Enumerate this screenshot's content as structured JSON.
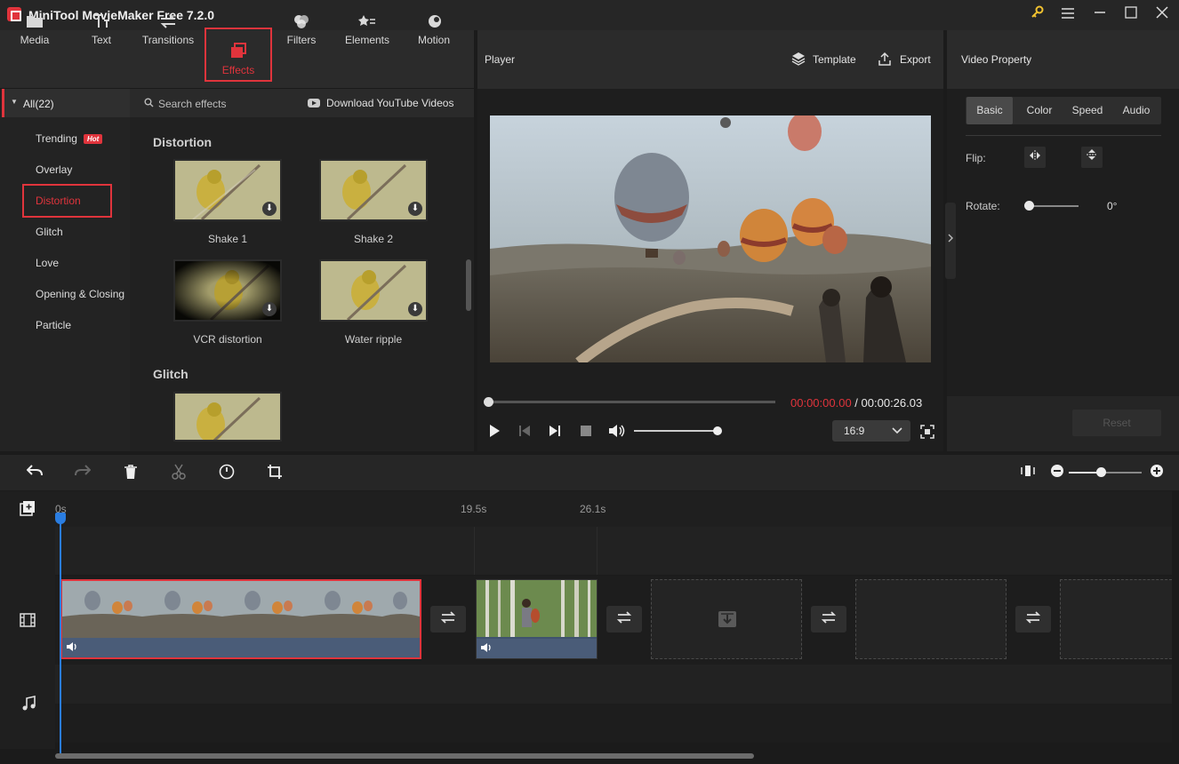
{
  "window": {
    "title": "MiniTool MovieMaker Free 7.2.0",
    "controls": [
      "key-icon",
      "menu-icon",
      "minimize-icon",
      "maximize-icon",
      "close-icon"
    ]
  },
  "toolbar": {
    "items": [
      {
        "label": "Media",
        "icon": "folder-icon"
      },
      {
        "label": "Text",
        "icon": "text-icon"
      },
      {
        "label": "Transitions",
        "icon": "swap-icon"
      },
      {
        "label": "Effects",
        "icon": "effects-icon",
        "selected": true
      },
      {
        "label": "Filters",
        "icon": "filters-icon"
      },
      {
        "label": "Elements",
        "icon": "elements-icon"
      },
      {
        "label": "Motion",
        "icon": "motion-icon"
      }
    ]
  },
  "categories": {
    "all_label": "All(22)",
    "items": [
      "Trending",
      "Overlay",
      "Distortion",
      "Glitch",
      "Love",
      "Opening & Closing",
      "Particle"
    ],
    "hot_badge": "Hot",
    "selected": "Distortion"
  },
  "effects": {
    "search_placeholder": "Search effects",
    "download_link": "Download YouTube Videos",
    "sections": [
      {
        "title": "Distortion",
        "items": [
          "Shake 1",
          "Shake 2",
          "VCR distortion",
          "Water ripple"
        ]
      },
      {
        "title": "Glitch",
        "items": [
          ""
        ]
      }
    ]
  },
  "player": {
    "title": "Player",
    "template_label": "Template",
    "export_label": "Export",
    "time_current": "00:00:00.00",
    "time_sep": " / ",
    "time_total": "00:00:26.03",
    "aspect": "16:9",
    "volume_level": 0.95,
    "progress": 0
  },
  "property": {
    "title": "Video Property",
    "tabs": [
      "Basic",
      "Color",
      "Speed",
      "Audio"
    ],
    "selected_tab": "Basic",
    "flip_label": "Flip:",
    "rotate_label": "Rotate:",
    "rotate_value": "0°",
    "reset_label": "Reset"
  },
  "timeline": {
    "marks": [
      "0s",
      "19.5s",
      "26.1s"
    ],
    "zoom_level": 0.44,
    "colors": {
      "accent": "#e0343c",
      "playhead": "#2a7de1"
    }
  }
}
